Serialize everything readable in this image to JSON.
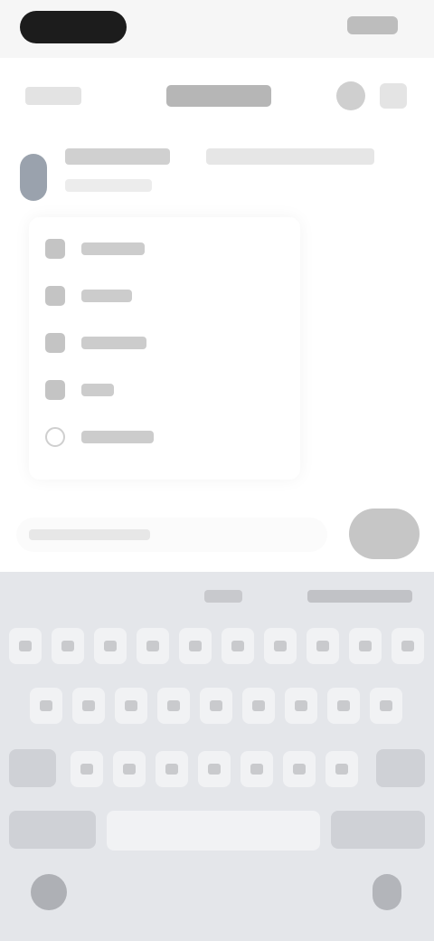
{
  "status_bar": {},
  "header": {},
  "message": {},
  "menu": {
    "items": [
      {
        "icon": "icon-1"
      },
      {
        "icon": "icon-2"
      },
      {
        "icon": "icon-3"
      },
      {
        "icon": "icon-4"
      },
      {
        "icon": "circle-outline-icon"
      }
    ]
  },
  "composer": {},
  "keyboard": {
    "rows": [
      10,
      9,
      9
    ]
  }
}
